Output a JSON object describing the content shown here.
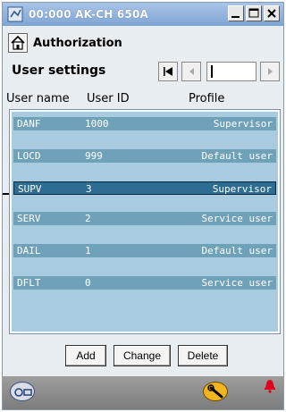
{
  "window": {
    "title": "00:000 AK-CH 650A"
  },
  "header": {
    "title": "Authorization"
  },
  "settings": {
    "title": "User settings"
  },
  "columns": {
    "name": "User name",
    "id": "User ID",
    "profile": "Profile"
  },
  "users": [
    {
      "name": "DANF",
      "id": "1000",
      "profile": "Supervisor"
    },
    {
      "name": "LOCD",
      "id": "999",
      "profile": "Default user"
    },
    {
      "name": "SUPV",
      "id": "3",
      "profile": "Supervisor"
    },
    {
      "name": "SERV",
      "id": "2",
      "profile": "Service user"
    },
    {
      "name": "DAIL",
      "id": "1",
      "profile": "Default user"
    },
    {
      "name": "DFLT",
      "id": "0",
      "profile": "Service user"
    }
  ],
  "selected_index": 2,
  "buttons": {
    "add": "Add",
    "change": "Change",
    "delete": "Delete"
  },
  "colors": {
    "list_bg": "#a9cbe0",
    "row": "#6fa2b8",
    "row_selected": "#2e6d92",
    "alarm": "#e0001b",
    "wrench_badge": "#f2b51f"
  }
}
